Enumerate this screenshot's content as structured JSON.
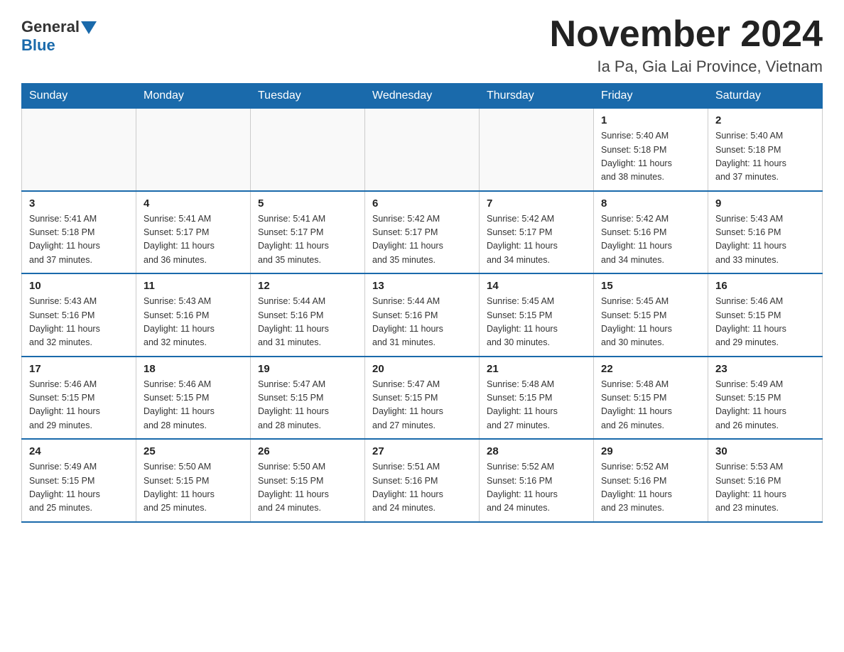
{
  "header": {
    "logo_general": "General",
    "logo_blue": "Blue",
    "month_title": "November 2024",
    "location": "Ia Pa, Gia Lai Province, Vietnam"
  },
  "days_of_week": [
    "Sunday",
    "Monday",
    "Tuesday",
    "Wednesday",
    "Thursday",
    "Friday",
    "Saturday"
  ],
  "weeks": [
    [
      {
        "day": "",
        "info": ""
      },
      {
        "day": "",
        "info": ""
      },
      {
        "day": "",
        "info": ""
      },
      {
        "day": "",
        "info": ""
      },
      {
        "day": "",
        "info": ""
      },
      {
        "day": "1",
        "info": "Sunrise: 5:40 AM\nSunset: 5:18 PM\nDaylight: 11 hours\nand 38 minutes."
      },
      {
        "day": "2",
        "info": "Sunrise: 5:40 AM\nSunset: 5:18 PM\nDaylight: 11 hours\nand 37 minutes."
      }
    ],
    [
      {
        "day": "3",
        "info": "Sunrise: 5:41 AM\nSunset: 5:18 PM\nDaylight: 11 hours\nand 37 minutes."
      },
      {
        "day": "4",
        "info": "Sunrise: 5:41 AM\nSunset: 5:17 PM\nDaylight: 11 hours\nand 36 minutes."
      },
      {
        "day": "5",
        "info": "Sunrise: 5:41 AM\nSunset: 5:17 PM\nDaylight: 11 hours\nand 35 minutes."
      },
      {
        "day": "6",
        "info": "Sunrise: 5:42 AM\nSunset: 5:17 PM\nDaylight: 11 hours\nand 35 minutes."
      },
      {
        "day": "7",
        "info": "Sunrise: 5:42 AM\nSunset: 5:17 PM\nDaylight: 11 hours\nand 34 minutes."
      },
      {
        "day": "8",
        "info": "Sunrise: 5:42 AM\nSunset: 5:16 PM\nDaylight: 11 hours\nand 34 minutes."
      },
      {
        "day": "9",
        "info": "Sunrise: 5:43 AM\nSunset: 5:16 PM\nDaylight: 11 hours\nand 33 minutes."
      }
    ],
    [
      {
        "day": "10",
        "info": "Sunrise: 5:43 AM\nSunset: 5:16 PM\nDaylight: 11 hours\nand 32 minutes."
      },
      {
        "day": "11",
        "info": "Sunrise: 5:43 AM\nSunset: 5:16 PM\nDaylight: 11 hours\nand 32 minutes."
      },
      {
        "day": "12",
        "info": "Sunrise: 5:44 AM\nSunset: 5:16 PM\nDaylight: 11 hours\nand 31 minutes."
      },
      {
        "day": "13",
        "info": "Sunrise: 5:44 AM\nSunset: 5:16 PM\nDaylight: 11 hours\nand 31 minutes."
      },
      {
        "day": "14",
        "info": "Sunrise: 5:45 AM\nSunset: 5:15 PM\nDaylight: 11 hours\nand 30 minutes."
      },
      {
        "day": "15",
        "info": "Sunrise: 5:45 AM\nSunset: 5:15 PM\nDaylight: 11 hours\nand 30 minutes."
      },
      {
        "day": "16",
        "info": "Sunrise: 5:46 AM\nSunset: 5:15 PM\nDaylight: 11 hours\nand 29 minutes."
      }
    ],
    [
      {
        "day": "17",
        "info": "Sunrise: 5:46 AM\nSunset: 5:15 PM\nDaylight: 11 hours\nand 29 minutes."
      },
      {
        "day": "18",
        "info": "Sunrise: 5:46 AM\nSunset: 5:15 PM\nDaylight: 11 hours\nand 28 minutes."
      },
      {
        "day": "19",
        "info": "Sunrise: 5:47 AM\nSunset: 5:15 PM\nDaylight: 11 hours\nand 28 minutes."
      },
      {
        "day": "20",
        "info": "Sunrise: 5:47 AM\nSunset: 5:15 PM\nDaylight: 11 hours\nand 27 minutes."
      },
      {
        "day": "21",
        "info": "Sunrise: 5:48 AM\nSunset: 5:15 PM\nDaylight: 11 hours\nand 27 minutes."
      },
      {
        "day": "22",
        "info": "Sunrise: 5:48 AM\nSunset: 5:15 PM\nDaylight: 11 hours\nand 26 minutes."
      },
      {
        "day": "23",
        "info": "Sunrise: 5:49 AM\nSunset: 5:15 PM\nDaylight: 11 hours\nand 26 minutes."
      }
    ],
    [
      {
        "day": "24",
        "info": "Sunrise: 5:49 AM\nSunset: 5:15 PM\nDaylight: 11 hours\nand 25 minutes."
      },
      {
        "day": "25",
        "info": "Sunrise: 5:50 AM\nSunset: 5:15 PM\nDaylight: 11 hours\nand 25 minutes."
      },
      {
        "day": "26",
        "info": "Sunrise: 5:50 AM\nSunset: 5:15 PM\nDaylight: 11 hours\nand 24 minutes."
      },
      {
        "day": "27",
        "info": "Sunrise: 5:51 AM\nSunset: 5:16 PM\nDaylight: 11 hours\nand 24 minutes."
      },
      {
        "day": "28",
        "info": "Sunrise: 5:52 AM\nSunset: 5:16 PM\nDaylight: 11 hours\nand 24 minutes."
      },
      {
        "day": "29",
        "info": "Sunrise: 5:52 AM\nSunset: 5:16 PM\nDaylight: 11 hours\nand 23 minutes."
      },
      {
        "day": "30",
        "info": "Sunrise: 5:53 AM\nSunset: 5:16 PM\nDaylight: 11 hours\nand 23 minutes."
      }
    ]
  ]
}
